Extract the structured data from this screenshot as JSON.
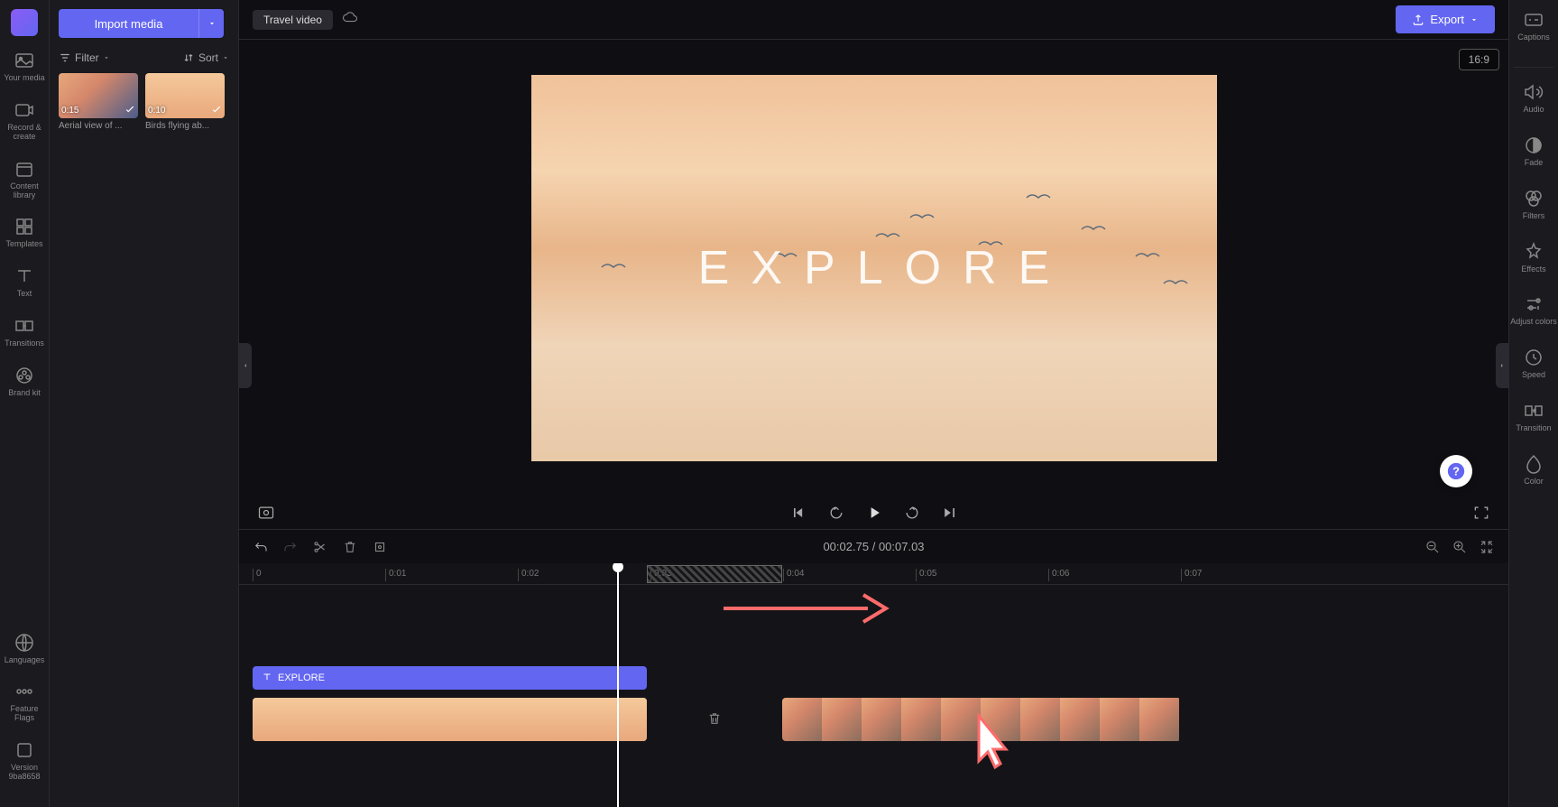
{
  "leftSidebar": {
    "items": [
      {
        "label": "Your media",
        "icon": "media-icon"
      },
      {
        "label": "Record & create",
        "icon": "record-icon"
      },
      {
        "label": "Content library",
        "icon": "library-icon"
      },
      {
        "label": "Templates",
        "icon": "templates-icon"
      },
      {
        "label": "Text",
        "icon": "text-icon"
      },
      {
        "label": "Transitions",
        "icon": "transitions-icon"
      },
      {
        "label": "Brand kit",
        "icon": "brandkit-icon"
      }
    ],
    "bottomItems": [
      {
        "label": "Languages",
        "icon": "languages-icon"
      },
      {
        "label": "Feature Flags",
        "icon": "flags-icon"
      },
      {
        "label": "Version 9ba8658",
        "icon": "version-icon"
      }
    ]
  },
  "mediaPanel": {
    "importLabel": "Import media",
    "filterLabel": "Filter",
    "sortLabel": "Sort",
    "items": [
      {
        "duration": "0:15",
        "title": "Aerial view of ..."
      },
      {
        "duration": "0:10",
        "title": "Birds flying ab..."
      }
    ]
  },
  "header": {
    "title": "Travel video",
    "exportLabel": "Export",
    "aspectRatio": "16:9"
  },
  "preview": {
    "overlayText": "EXPLORE"
  },
  "timecode": {
    "current": "00:02.75",
    "separator": "/",
    "total": "00:07.03"
  },
  "timeline": {
    "ruler": [
      "0",
      "0:01",
      "0:02",
      "0:03",
      "0:04",
      "0:05",
      "0:06",
      "0:07"
    ],
    "textClip": {
      "label": "EXPLORE"
    }
  },
  "rightSidebar": {
    "items": [
      {
        "label": "Captions",
        "icon": "captions-icon"
      },
      {
        "label": "Audio",
        "icon": "audio-icon"
      },
      {
        "label": "Fade",
        "icon": "fade-icon"
      },
      {
        "label": "Filters",
        "icon": "filters-icon"
      },
      {
        "label": "Effects",
        "icon": "effects-icon"
      },
      {
        "label": "Adjust colors",
        "icon": "adjust-icon"
      },
      {
        "label": "Speed",
        "icon": "speed-icon"
      },
      {
        "label": "Transition",
        "icon": "transition-icon"
      },
      {
        "label": "Color",
        "icon": "color-icon"
      }
    ]
  }
}
